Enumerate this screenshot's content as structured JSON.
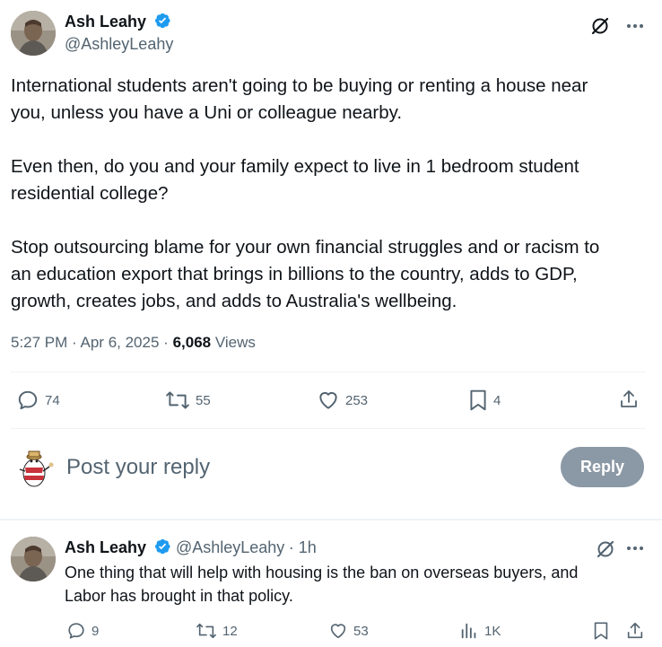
{
  "colors": {
    "verified": "#1d9bf0",
    "secondary_text": "#536471",
    "primary_text": "#0f1419",
    "reply_button_bg": "#8b98a5"
  },
  "tweet": {
    "author_name": "Ash Leahy",
    "author_handle": "@AshleyLeahy",
    "text": "International students aren't going to be buying or renting a house near\nyou, unless you have a Uni or colleague nearby.\n\nEven then, do you and your family expect to live in 1 bedroom student\nresidential college?\n\nStop outsourcing blame for your own financial struggles and or racism to\nan education export that brings in billions to the country, adds to GDP,\ngrowth, creates jobs, and adds to Australia's wellbeing.",
    "time": "5:27 PM",
    "date": "Apr 6, 2025",
    "separator": "·",
    "views_count": "6,068",
    "views_label": "Views",
    "stats": {
      "replies": "74",
      "retweets": "55",
      "likes": "253",
      "bookmarks": "4"
    }
  },
  "composer": {
    "placeholder": "Post your reply",
    "button_label": "Reply"
  },
  "reply": {
    "author_name": "Ash Leahy",
    "author_handle": "@AshleyLeahy",
    "age": "· 1h",
    "text": "One thing that will help with housing is the ban on overseas buyers, and\nLabor has brought in that policy.",
    "stats": {
      "replies": "9",
      "retweets": "12",
      "likes": "53",
      "views": "1K"
    }
  },
  "icons": {
    "verified": "verified-badge-icon",
    "grok": "grok-icon",
    "more": "more-icon",
    "reply": "reply-icon",
    "retweet": "retweet-icon",
    "like": "heart-icon",
    "bookmark": "bookmark-icon",
    "share": "share-icon",
    "views": "views-icon"
  }
}
